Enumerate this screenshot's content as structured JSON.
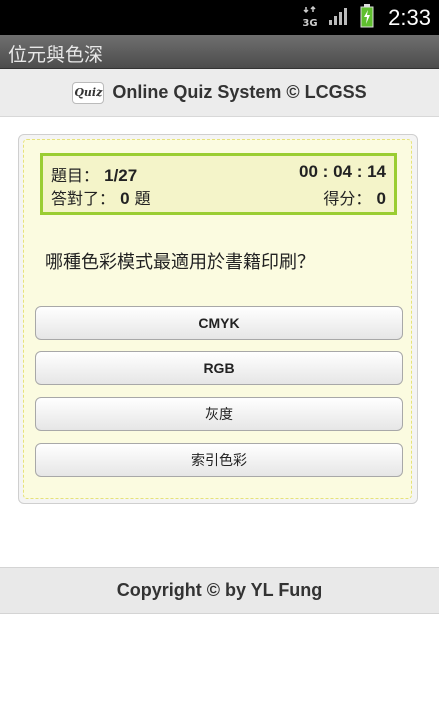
{
  "status_bar": {
    "network_label": "3G",
    "time": "2:33",
    "icons": [
      "network-3g-icon",
      "signal-icon",
      "battery-charging-icon"
    ]
  },
  "window": {
    "title": "位元與色深"
  },
  "header": {
    "logo_text": "Quiz",
    "title": "Online Quiz System © LCGSS"
  },
  "score": {
    "question_label": "題目：",
    "question_value": "1/27",
    "timer": "00 : 04 : 14",
    "answered_label": "答對了：",
    "answered_value": "0",
    "answered_unit": "題",
    "score_label": "得分：",
    "score_value": "0"
  },
  "question": {
    "text": "哪種色彩模式最適用於書籍印刷？"
  },
  "options": [
    {
      "label": "CMYK"
    },
    {
      "label": "RGB"
    },
    {
      "label": "灰度"
    },
    {
      "label": "索引色彩"
    }
  ],
  "footer": {
    "copyright": "Copyright © by YL Fung"
  },
  "colors": {
    "status_bar_bg": "#000000",
    "title_bar_bg": "#5a5a5a",
    "score_border": "#9acd32",
    "panel_bg": "#fbfbe0"
  }
}
